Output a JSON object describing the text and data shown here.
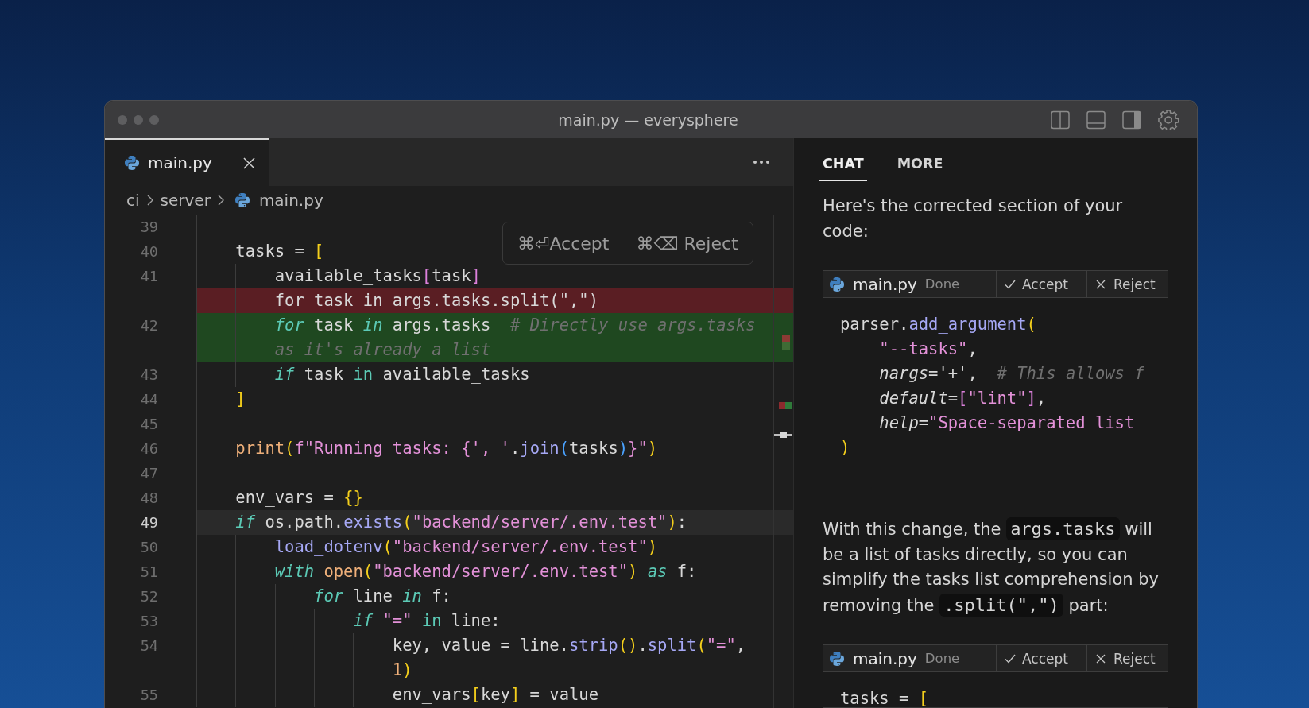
{
  "window": {
    "title": "main.py — everysphere"
  },
  "editor": {
    "tabs": [
      {
        "label": "main.py",
        "selected": true
      }
    ],
    "breadcrumb": [
      {
        "label": "ci",
        "kind": "folder"
      },
      {
        "label": "server",
        "kind": "folder"
      },
      {
        "label": "main.py",
        "kind": "file"
      }
    ],
    "diff_popup": {
      "buttons": [
        "⌘⏎Accept",
        "⌘⌫ Reject"
      ]
    },
    "lines": [
      {
        "number": "39",
        "kind": "context",
        "current": false
      },
      {
        "number": "40",
        "kind": "context",
        "current": false,
        "tokens": [
          {
            "text": "tasks = ",
            "kind": "plain"
          },
          {
            "text": "[",
            "kind": "bracket"
          }
        ],
        "children": [
          {
            "number": "41",
            "kind": "context",
            "current": false,
            "tokens": [
              {
                "text": "available_tasks",
                "kind": "plain"
              },
              {
                "text": "[",
                "kind": "bracket2"
              },
              {
                "text": "task",
                "kind": "plain"
              },
              {
                "text": "]",
                "kind": "bracket2"
              }
            ]
          },
          {
            "kind": "removed",
            "current": false,
            "tokens": [
              {
                "text": "for task in args.tasks.split(\",\")",
                "kind": "plain"
              }
            ]
          },
          {
            "number": "42",
            "kind": "added",
            "current": false,
            "tokens": [
              {
                "text": "for",
                "kind": "keyword"
              },
              {
                "text": " task ",
                "kind": "plain"
              },
              {
                "text": "in",
                "kind": "keyword"
              },
              {
                "text": " args.tasks  ",
                "kind": "plain"
              },
              {
                "text": "# Directly use args.tasks as it's already a list",
                "kind": "comment"
              }
            ]
          },
          {
            "number": "43",
            "kind": "context",
            "current": false,
            "tokens": [
              {
                "text": "if",
                "kind": "keyword"
              },
              {
                "text": " task ",
                "kind": "plain"
              },
              {
                "text": "in",
                "kind": "operator"
              },
              {
                "text": " available_tasks",
                "kind": "plain"
              }
            ]
          }
        ]
      },
      {
        "number": "44",
        "kind": "context",
        "current": false,
        "tokens": [
          {
            "text": "]",
            "kind": "bracket"
          }
        ]
      },
      {
        "number": "45",
        "kind": "context",
        "current": false
      },
      {
        "number": "46",
        "kind": "context",
        "current": false,
        "tokens": [
          {
            "text": "print",
            "kind": "builtin"
          },
          {
            "text": "(",
            "kind": "bracket"
          },
          {
            "text": "f\"Running tasks: {', '",
            "kind": "string"
          },
          {
            "text": ".",
            "kind": "plain"
          },
          {
            "text": "join",
            "kind": "function"
          },
          {
            "text": "(",
            "kind": "bracket3"
          },
          {
            "text": "tasks",
            "kind": "plain"
          },
          {
            "text": ")",
            "kind": "bracket3"
          },
          {
            "text": "}\"",
            "kind": "string"
          },
          {
            "text": ")",
            "kind": "bracket"
          }
        ]
      },
      {
        "number": "47",
        "kind": "context",
        "current": false
      },
      {
        "number": "48",
        "kind": "context",
        "current": false,
        "tokens": [
          {
            "text": "env_vars = ",
            "kind": "plain"
          },
          {
            "text": "{}",
            "kind": "bracket"
          }
        ]
      },
      {
        "number": "49",
        "kind": "context",
        "current": true,
        "tokens": [
          {
            "text": "if",
            "kind": "keyword"
          },
          {
            "text": " os.path.",
            "kind": "plain"
          },
          {
            "text": "exists",
            "kind": "function"
          },
          {
            "text": "(",
            "kind": "bracket"
          },
          {
            "text": "\"backend/server/.env.test\"",
            "kind": "string"
          },
          {
            "text": ")",
            "kind": "bracket"
          },
          {
            "text": ":",
            "kind": "plain"
          }
        ],
        "children": [
          {
            "number": "50",
            "kind": "context",
            "current": false,
            "tokens": [
              {
                "text": "load_dotenv",
                "kind": "function"
              },
              {
                "text": "(",
                "kind": "bracket"
              },
              {
                "text": "\"backend/server/.env.test\"",
                "kind": "string"
              },
              {
                "text": ")",
                "kind": "bracket"
              }
            ]
          },
          {
            "number": "51",
            "kind": "context",
            "current": false,
            "tokens": [
              {
                "text": "with ",
                "kind": "keyword"
              },
              {
                "text": "open",
                "kind": "builtin"
              },
              {
                "text": "(",
                "kind": "bracket"
              },
              {
                "text": "\"backend/server/.env.test\"",
                "kind": "string"
              },
              {
                "text": ")",
                "kind": "bracket"
              },
              {
                "text": " as",
                "kind": "keyword"
              },
              {
                "text": " f:",
                "kind": "plain"
              }
            ],
            "children": [
              {
                "number": "52",
                "kind": "context",
                "current": false,
                "tokens": [
                  {
                    "text": "for",
                    "kind": "keyword"
                  },
                  {
                    "text": " line ",
                    "kind": "plain"
                  },
                  {
                    "text": "in",
                    "kind": "keyword"
                  },
                  {
                    "text": " f:",
                    "kind": "plain"
                  }
                ],
                "children": [
                  {
                    "number": "53",
                    "kind": "context",
                    "current": false,
                    "tokens": [
                      {
                        "text": "if ",
                        "kind": "keyword"
                      },
                      {
                        "text": "\"=\" ",
                        "kind": "string"
                      },
                      {
                        "text": "in",
                        "kind": "operator"
                      },
                      {
                        "text": " line:",
                        "kind": "plain"
                      }
                    ],
                    "children": [
                      {
                        "number": "54",
                        "kind": "context",
                        "current": false,
                        "tokens": [
                          {
                            "text": "key, value = line.",
                            "kind": "plain"
                          },
                          {
                            "text": "strip",
                            "kind": "function"
                          },
                          {
                            "text": "()",
                            "kind": "bracket"
                          },
                          {
                            "text": ".",
                            "kind": "plain"
                          },
                          {
                            "text": "split",
                            "kind": "function"
                          },
                          {
                            "text": "(",
                            "kind": "bracket"
                          },
                          {
                            "text": "\"=\"",
                            "kind": "string"
                          },
                          {
                            "text": ", ",
                            "kind": "plain"
                          },
                          {
                            "text": "1",
                            "kind": "number"
                          },
                          {
                            "text": ")",
                            "kind": "bracket"
                          }
                        ]
                      },
                      {
                        "number": "55",
                        "kind": "context",
                        "current": false,
                        "tokens": [
                          {
                            "text": "env_vars",
                            "kind": "plain"
                          },
                          {
                            "text": "[",
                            "kind": "bracket"
                          },
                          {
                            "text": "key",
                            "kind": "plain"
                          },
                          {
                            "text": "]",
                            "kind": "bracket"
                          },
                          {
                            "text": " = value",
                            "kind": "plain"
                          }
                        ]
                      }
                    ]
                  }
                ]
              }
            ]
          }
        ]
      }
    ]
  },
  "chat": {
    "tabs": [
      {
        "label": "CHAT",
        "selected": true
      },
      {
        "label": "MORE",
        "selected": false
      }
    ],
    "messages": [
      {
        "kind": "text",
        "segments": [
          {
            "kind": "text",
            "text": "Here's the corrected section of your code:"
          }
        ]
      },
      {
        "kind": "code_block",
        "file": "main.py",
        "status": "Done",
        "actions": [
          {
            "kind": "accept",
            "label": "Accept"
          },
          {
            "kind": "reject",
            "label": "Reject"
          }
        ],
        "lines": [
          {
            "tokens": [
              {
                "text": "parser.",
                "kind": "plain"
              },
              {
                "text": "add_argument",
                "kind": "function"
              },
              {
                "text": "(",
                "kind": "bracket"
              }
            ],
            "children": [
              {
                "tokens": [
                  {
                    "text": "\"--tasks\"",
                    "kind": "string"
                  },
                  {
                    "text": ",",
                    "kind": "plain"
                  }
                ]
              },
              {
                "tokens": [
                  {
                    "text": "nargs",
                    "kind": "parameter"
                  },
                  {
                    "text": "='+',  ",
                    "kind": "plain"
                  },
                  {
                    "text": "# This allows f",
                    "kind": "comment"
                  }
                ]
              },
              {
                "tokens": [
                  {
                    "text": "default",
                    "kind": "parameter"
                  },
                  {
                    "text": "=",
                    "kind": "plain"
                  },
                  {
                    "text": "[",
                    "kind": "bracket2"
                  },
                  {
                    "text": "\"lint\"",
                    "kind": "string"
                  },
                  {
                    "text": "]",
                    "kind": "bracket2"
                  },
                  {
                    "text": ",",
                    "kind": "plain"
                  }
                ]
              },
              {
                "tokens": [
                  {
                    "text": "help",
                    "kind": "parameter"
                  },
                  {
                    "text": "=",
                    "kind": "plain"
                  },
                  {
                    "text": "\"Space-separated list",
                    "kind": "string"
                  }
                ]
              }
            ]
          },
          {
            "tokens": [
              {
                "text": ")",
                "kind": "bracket"
              }
            ]
          }
        ]
      },
      {
        "kind": "text",
        "segments": [
          {
            "kind": "text",
            "text": "With this change, the "
          },
          {
            "kind": "code",
            "text": "args.tasks"
          },
          {
            "kind": "text",
            "text": " will be a list of tasks directly, so you can simplify the tasks list comprehension by removing the "
          },
          {
            "kind": "code",
            "text": ".split(\",\")"
          },
          {
            "kind": "text",
            "text": " part:"
          }
        ]
      },
      {
        "kind": "code_block",
        "file": "main.py",
        "status": "Done",
        "actions": [
          {
            "kind": "accept",
            "label": "Accept"
          },
          {
            "kind": "reject",
            "label": "Reject"
          }
        ],
        "lines": [
          {
            "tokens": [
              {
                "text": "tasks = ",
                "kind": "plain"
              },
              {
                "text": "[",
                "kind": "bracket"
              }
            ]
          }
        ]
      }
    ]
  }
}
